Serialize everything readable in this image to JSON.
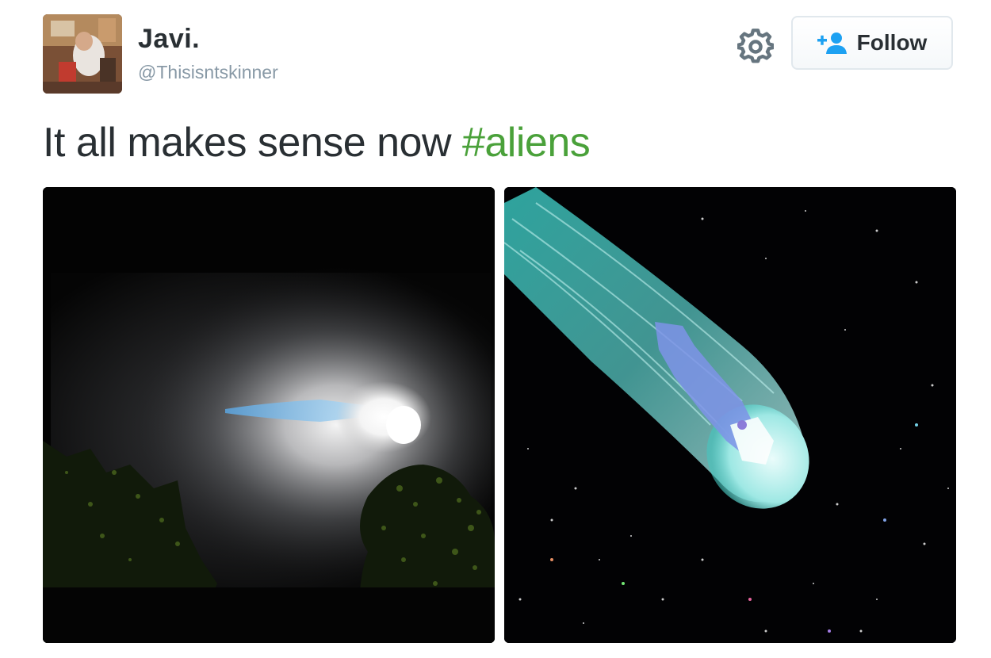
{
  "tweet": {
    "user_name": "Javi.",
    "user_handle": "@Thisisntskinner",
    "follow_label": "Follow",
    "text_plain": "It all makes sense now ",
    "hashtag": "#aliens",
    "icons": {
      "avatar": "user-avatar-photo",
      "settings": "gear-icon",
      "follow": "add-user-icon"
    },
    "colors": {
      "name": "#292f33",
      "handle": "#8899a6",
      "hashtag": "#4aa13a",
      "follow_icon": "#1da1f2"
    },
    "media": [
      {
        "description_icon": "night-sky-light-trail-photo"
      },
      {
        "description_icon": "cartoon-comet-space-image"
      }
    ]
  }
}
